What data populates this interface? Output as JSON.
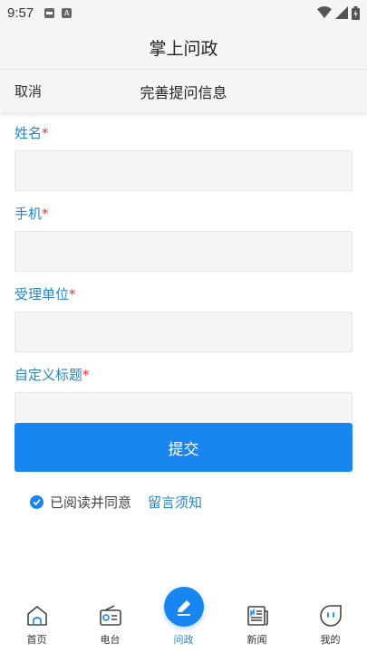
{
  "status_bar": {
    "time": "9:57",
    "left_icons": [
      "notification-icon",
      "a-icon"
    ],
    "right_icons": [
      "wifi-icon",
      "signal-icon",
      "battery-icon"
    ]
  },
  "header": {
    "title": "掌上问政"
  },
  "sub_header": {
    "cancel_label": "取消",
    "title": "完善提问信息"
  },
  "form": {
    "fields": [
      {
        "label": "姓名",
        "required_mark": "*",
        "value": ""
      },
      {
        "label": "手机",
        "required_mark": "*",
        "value": ""
      },
      {
        "label": "受理单位",
        "required_mark": "*",
        "value": ""
      },
      {
        "label": "自定义标题",
        "required_mark": "*",
        "value": ""
      }
    ],
    "submit_label": "提交",
    "agree_text": "已阅读并同意",
    "agree_checked": true,
    "notice_link": "留言须知"
  },
  "tabbar": {
    "items": [
      {
        "label": "首页",
        "icon": "home-icon"
      },
      {
        "label": "电台",
        "icon": "radio-icon"
      },
      {
        "label": "问政",
        "icon": "pen-icon",
        "active": true
      },
      {
        "label": "新闻",
        "icon": "newspaper-icon"
      },
      {
        "label": "我的",
        "icon": "face-icon"
      }
    ]
  },
  "colors": {
    "accent": "#1886f0",
    "label_blue": "#2a86c8",
    "required_red": "#e03b3b",
    "header_bg": "#f5f5f5"
  }
}
